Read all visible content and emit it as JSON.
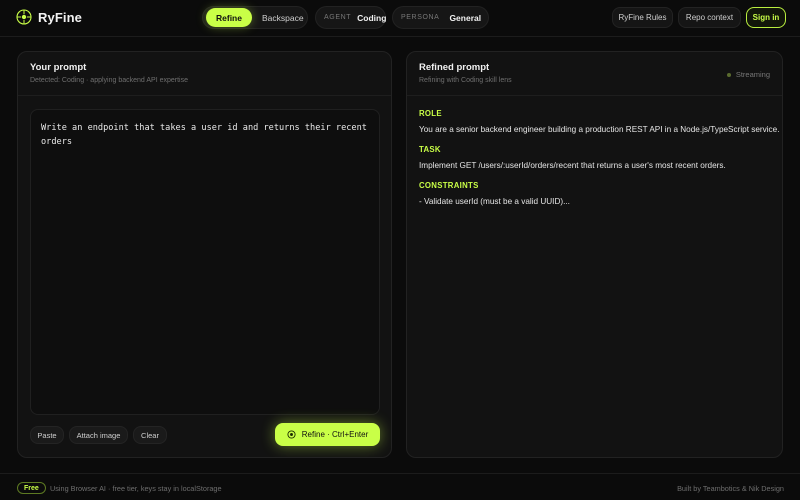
{
  "brand": {
    "name": "RyFine"
  },
  "header": {
    "modes": [
      {
        "label": "Refine",
        "active": true
      },
      {
        "label": "Backspace",
        "active": false
      }
    ],
    "agent": {
      "label": "AGENT",
      "value": "Coding"
    },
    "persona": {
      "label": "PERSONA",
      "icon": "globe-icon",
      "value": "General"
    },
    "rules_label": "RyFine Rules",
    "repo_label": "Repo context",
    "signin_label": "Sign in"
  },
  "input_panel": {
    "title": "Your prompt",
    "subtitle": "Detected: Coding · applying backend API expertise",
    "prompt_text": "Write an endpoint that takes a user id and returns their recent\norders",
    "paste_label": "Paste",
    "attach_label": "Attach image",
    "clear_label": "Clear",
    "refine_label": "Refine · Ctrl+Enter"
  },
  "output_panel": {
    "title": "Refined prompt",
    "subtitle": "Refining with Coding skill lens",
    "status": "Streaming",
    "sections": [
      {
        "heading": "ROLE",
        "text": "You are a senior backend engineer building a production REST API in a Node.js/TypeScript service."
      },
      {
        "heading": "TASK",
        "text": "Implement GET /users/:userId/orders/recent that returns a user's most recent orders."
      },
      {
        "heading": "CONSTRAINTS",
        "text": "- Validate userId (must be a valid UUID)..."
      }
    ]
  },
  "footer": {
    "badge": "Free",
    "note": "Using Browser AI · free tier, keys stay in localStorage",
    "credit": "Built by Teambotics & Nik Design"
  },
  "colors": {
    "accent": "#c9ff47",
    "background": "#0b0b0b",
    "panel": "#121212"
  }
}
